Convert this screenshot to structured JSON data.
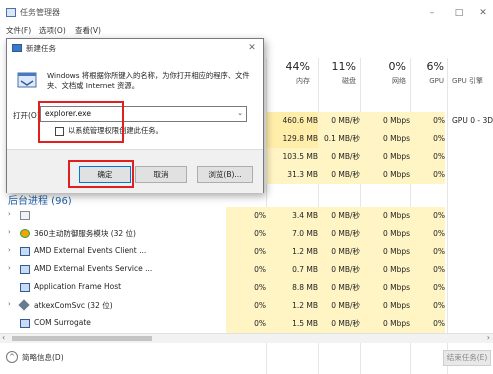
{
  "window": {
    "title": "任务管理器",
    "menu": [
      "文件(F)",
      "选项(O)",
      "查看(V)"
    ],
    "controls": {
      "minimize": "–",
      "maximize": "□",
      "close": "✕"
    }
  },
  "columns": {
    "cpu_pct": "",
    "cpu_label": "",
    "mem_pct": "44%",
    "mem_label": "内存",
    "disk_pct": "11%",
    "disk_label": "磁盘",
    "net_pct": "0%",
    "net_label": "网络",
    "gpu_pct": "6%",
    "gpu_label": "GPU",
    "engine_label": "GPU 引擎"
  },
  "top_rows": [
    {
      "cpu": "",
      "mem": "460.6 MB",
      "disk": "0 MB/秒",
      "net": "0 Mbps",
      "gpu": "0%",
      "engine": "GPU 0 - 3D"
    },
    {
      "cpu": "",
      "mem": "129.8 MB",
      "disk": "0.1 MB/秒",
      "net": "0 Mbps",
      "gpu": "0%",
      "engine": ""
    },
    {
      "cpu": "",
      "mem": "103.5 MB",
      "disk": "0 MB/秒",
      "net": "0 Mbps",
      "gpu": "0%",
      "engine": ""
    },
    {
      "cpu": "",
      "mem": "31.3 MB",
      "disk": "0 MB/秒",
      "net": "0 Mbps",
      "gpu": "0%",
      "engine": ""
    }
  ],
  "section_title": "后台进程 (96)",
  "bg_rows": [
    {
      "name": "",
      "cpu": "0%",
      "mem": "3.4 MB",
      "disk": "0 MB/秒",
      "net": "0 Mbps",
      "gpu": "0%"
    },
    {
      "name": "360主动防御服务模块 (32 位)",
      "cpu": "0%",
      "mem": "7.0 MB",
      "disk": "0 MB/秒",
      "net": "0 Mbps",
      "gpu": "0%"
    },
    {
      "name": "AMD External Events Client ...",
      "cpu": "0%",
      "mem": "1.2 MB",
      "disk": "0 MB/秒",
      "net": "0 Mbps",
      "gpu": "0%"
    },
    {
      "name": "AMD External Events Service ...",
      "cpu": "0%",
      "mem": "0.7 MB",
      "disk": "0 MB/秒",
      "net": "0 Mbps",
      "gpu": "0%"
    },
    {
      "name": "Application Frame Host",
      "cpu": "0%",
      "mem": "8.8 MB",
      "disk": "0 MB/秒",
      "net": "0 Mbps",
      "gpu": "0%"
    },
    {
      "name": "atkexComSvc (32 位)",
      "cpu": "0%",
      "mem": "1.2 MB",
      "disk": "0 MB/秒",
      "net": "0 Mbps",
      "gpu": "0%"
    },
    {
      "name": "COM Surrogate",
      "cpu": "0%",
      "mem": "1.5 MB",
      "disk": "0 MB/秒",
      "net": "0 Mbps",
      "gpu": "0%"
    }
  ],
  "footer": {
    "fewer_details": "简略信息(D)",
    "end_task": "结束任务(E)"
  },
  "dialog": {
    "title": "新建任务",
    "description": "Windows 将根据你所键入的名称，为你打开相应的程序、文件夹、文档或 Internet 资源。",
    "open_label": "打开(O):",
    "open_value": "explorer.exe",
    "admin_checkbox": "以系统管理权限创建此任务。",
    "ok": "确定",
    "cancel": "取消",
    "browse": "浏览(B)..."
  }
}
